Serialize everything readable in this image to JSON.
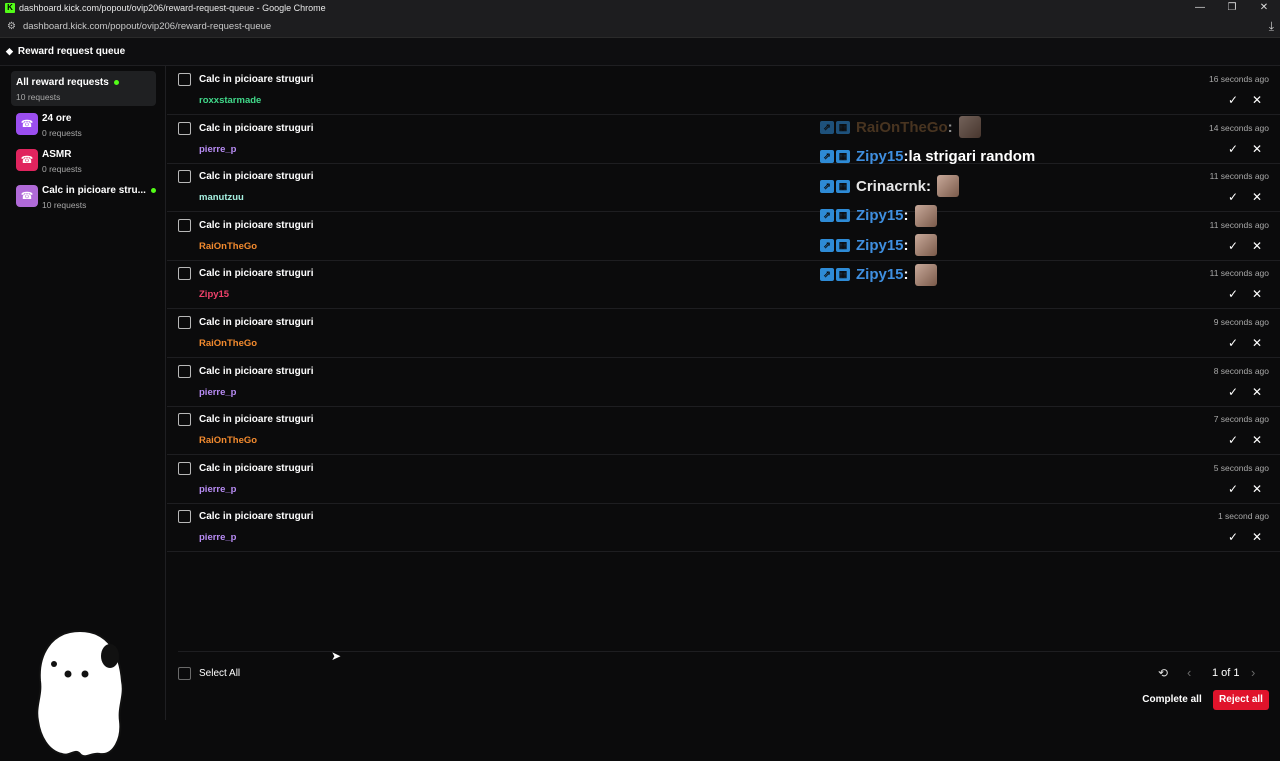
{
  "window": {
    "title": "dashboard.kick.com/popout/ovip206/reward-request-queue - Google Chrome",
    "url": "dashboard.kick.com/popout/ovip206/reward-request-queue",
    "minimize": "—",
    "restore": "❐",
    "close": "✕"
  },
  "header": {
    "title": "Reward request queue"
  },
  "sidebar": {
    "items": [
      {
        "title": "All reward requests",
        "sub": "10 requests",
        "dot": true
      },
      {
        "title": "24 ore",
        "sub": "0 requests",
        "color": "#9b4ef0"
      },
      {
        "title": "ASMR",
        "sub": "0 requests",
        "color": "#e0245e"
      },
      {
        "title": "Calc in picioare stru...",
        "sub": "10 requests",
        "color": "#b06ad8",
        "dot": true
      }
    ]
  },
  "requests": [
    {
      "title": "Calc in picioare struguri",
      "user": "roxxstarmade",
      "user_color": "#41d98a",
      "time": "16 seconds ago"
    },
    {
      "title": "Calc in picioare struguri",
      "user": "pierre_p",
      "user_color": "#b88cf5",
      "time": "14 seconds ago"
    },
    {
      "title": "Calc in picioare struguri",
      "user": "manutzuu",
      "user_color": "#a6f0e0",
      "time": "11 seconds ago"
    },
    {
      "title": "Calc in picioare struguri",
      "user": "RaiOnTheGo",
      "user_color": "#f28a2e",
      "time": "11 seconds ago"
    },
    {
      "title": "Calc in picioare struguri",
      "user": "Zipy15",
      "user_color": "#f0426b",
      "time": "11 seconds ago"
    },
    {
      "title": "Calc in picioare struguri",
      "user": "RaiOnTheGo",
      "user_color": "#f28a2e",
      "time": "9 seconds ago"
    },
    {
      "title": "Calc in picioare struguri",
      "user": "pierre_p",
      "user_color": "#b88cf5",
      "time": "8 seconds ago"
    },
    {
      "title": "Calc in picioare struguri",
      "user": "RaiOnTheGo",
      "user_color": "#f28a2e",
      "time": "7 seconds ago"
    },
    {
      "title": "Calc in picioare struguri",
      "user": "pierre_p",
      "user_color": "#b88cf5",
      "time": "5 seconds ago"
    },
    {
      "title": "Calc in picioare struguri",
      "user": "pierre_p",
      "user_color": "#b88cf5",
      "time": "1 second ago"
    }
  ],
  "chat_overlay": [
    {
      "user": "RaiOnTheGo",
      "user_color": "#7a5632",
      "sep": " :",
      "message": "",
      "emote": true,
      "faded": true
    },
    {
      "user": "Zipy15",
      "user_color": "#3f8fe0",
      "sep": " :",
      "message": " la strigari random",
      "emote": false
    },
    {
      "user": "Crinacrnk",
      "user_color": "#e6e6e6",
      "sep": " :",
      "message": "",
      "emote": true
    },
    {
      "user": "Zipy15",
      "user_color": "#3f8fe0",
      "sep": " :",
      "message": "",
      "emote": true
    },
    {
      "user": "Zipy15",
      "user_color": "#3f8fe0",
      "sep": " :",
      "message": "",
      "emote": true
    },
    {
      "user": "Zipy15",
      "user_color": "#3f8fe0",
      "sep": " :",
      "message": "",
      "emote": true
    }
  ],
  "footer": {
    "select_all": "Select All",
    "pagination": "1 of 1",
    "complete_all": "Complete all",
    "reject_all": "Reject all"
  },
  "icons": {
    "accept": "✓",
    "reject": "✕",
    "prev": "‹",
    "next": "›",
    "history": "⟲",
    "download": "⤓",
    "tune": "⚙"
  }
}
